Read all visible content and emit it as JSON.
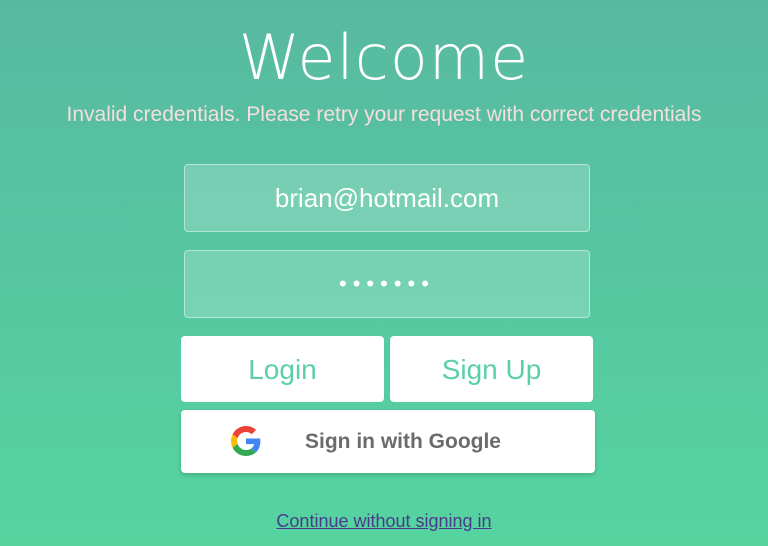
{
  "header": {
    "title": "Welcome",
    "error_message": "Invalid credentials. Please retry your request with correct credentials"
  },
  "form": {
    "email_value": "brian@hotmail.com",
    "password_value": "•••••••"
  },
  "buttons": {
    "login_label": "Login",
    "signup_label": "Sign Up",
    "google_label": "Sign in with Google"
  },
  "footer": {
    "continue_link": "Continue without signing in"
  },
  "colors": {
    "background_top": "#58b9a1",
    "background_bottom": "#55d4a0",
    "button_text": "#5bd0a4",
    "error_text": "#f7dede",
    "link": "#4b3a8a"
  },
  "icons": {
    "google": "google-g-icon"
  }
}
